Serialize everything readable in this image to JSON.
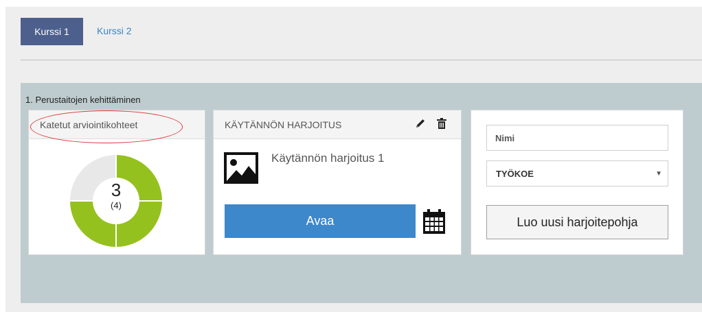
{
  "tabs": [
    {
      "label": "Kurssi 1",
      "active": true
    },
    {
      "label": "Kurssi 2",
      "active": false
    }
  ],
  "section": {
    "title": "1. Perustaitojen kehittäminen"
  },
  "coverage_card": {
    "title": "Katetut arviointikohteet",
    "covered": "3",
    "total": "(4)",
    "covered_fraction": 0.75,
    "colors": {
      "covered": "#95c11f",
      "uncovered": "#e8e8e8"
    }
  },
  "exercise_card": {
    "title": "KÄYTÄNNÖN HARJOITUS",
    "name": "Käytännön harjoitus 1",
    "open_label": "Avaa",
    "icons": [
      "edit-icon",
      "trash-icon",
      "image-icon",
      "calendar-icon"
    ],
    "accent": "#3d87cb"
  },
  "new_template_card": {
    "name_placeholder": "Nimi",
    "type_selected": "TYÖKOE",
    "create_label": "Luo uusi harjoitepohja"
  }
}
